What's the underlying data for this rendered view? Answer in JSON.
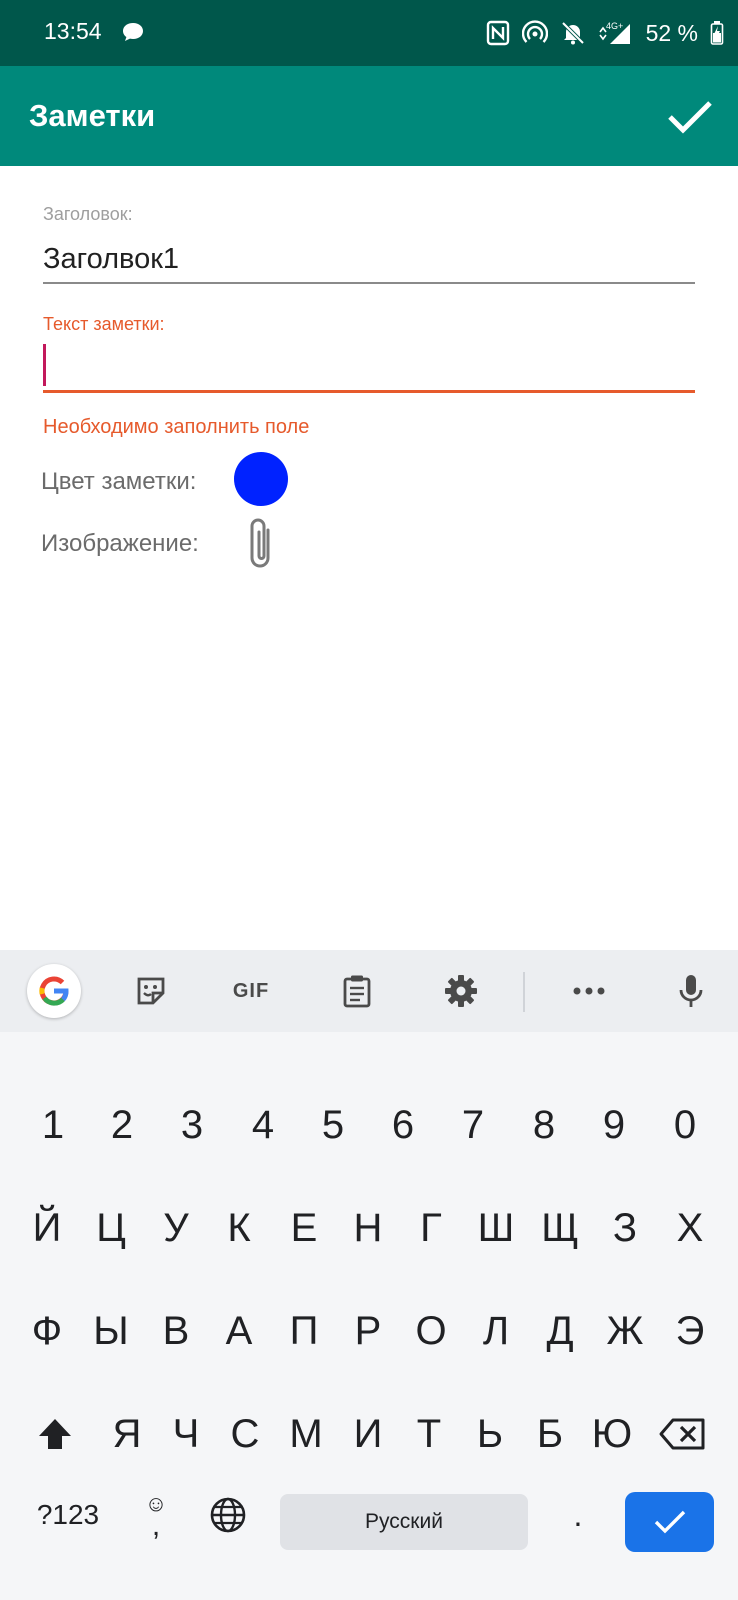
{
  "status_bar": {
    "time": "13:54",
    "battery": "52 %"
  },
  "app_bar": {
    "title": "Заметки"
  },
  "form": {
    "title_label": "Заголовок:",
    "title_value": "Заголвок1",
    "note_label": "Текст заметки:",
    "note_value": "",
    "error": "Необходимо заполнить поле",
    "color_label": "Цвет заметки:",
    "note_color": "#0022ff",
    "image_label": "Изображение:"
  },
  "keyboard": {
    "gif_label": "GIF",
    "number_row": [
      "1",
      "2",
      "3",
      "4",
      "5",
      "6",
      "7",
      "8",
      "9",
      "0"
    ],
    "row1": [
      "Й",
      "Ц",
      "У",
      "К",
      "Е",
      "Н",
      "Г",
      "Ш",
      "Щ",
      "З",
      "Х"
    ],
    "row2": [
      "Ф",
      "Ы",
      "В",
      "А",
      "П",
      "Р",
      "О",
      "Л",
      "Д",
      "Ж",
      "Э"
    ],
    "row3": [
      "Я",
      "Ч",
      "С",
      "М",
      "И",
      "Т",
      "Ь",
      "Б",
      "Ю"
    ],
    "symbols_key": "?123",
    "comma_key": ",",
    "space_label": "Русский",
    "period_key": "."
  }
}
